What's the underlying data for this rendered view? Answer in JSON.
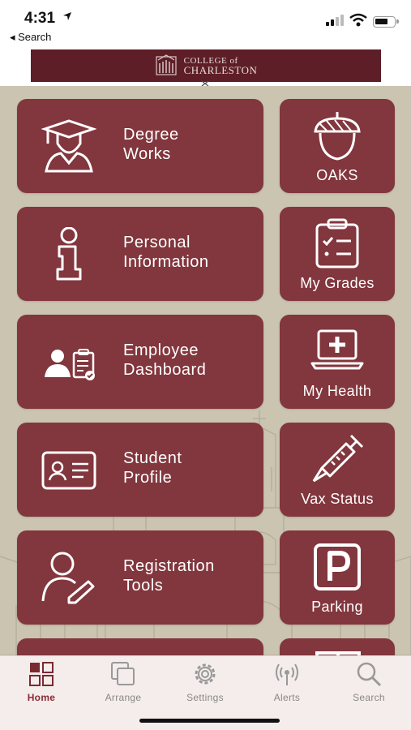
{
  "status_bar": {
    "time": "4:31",
    "back_label": "◂ Search"
  },
  "banner": {
    "brand_line1": "COLLEGE of",
    "brand_line2": "CHARLESTON"
  },
  "tiles": [
    {
      "label": "Degree\nWorks",
      "icon": "graduate-icon"
    },
    {
      "label": "OAKS",
      "icon": "acorn-icon"
    },
    {
      "label": "Personal\nInformation",
      "icon": "info-icon"
    },
    {
      "label": "My Grades",
      "icon": "clipboard-checklist-icon"
    },
    {
      "label": "Employee\nDashboard",
      "icon": "employee-clipboard-icon"
    },
    {
      "label": "My Health",
      "icon": "laptop-medical-icon"
    },
    {
      "label": "Student\nProfile",
      "icon": "id-card-icon"
    },
    {
      "label": "Vax Status",
      "icon": "syringe-icon"
    },
    {
      "label": "Registration\nTools",
      "icon": "user-edit-icon"
    },
    {
      "label": "Parking",
      "icon": "parking-icon"
    }
  ],
  "tabbar": {
    "tabs": [
      {
        "label": "Home",
        "icon": "grid-icon",
        "active": true
      },
      {
        "label": "Arrange",
        "icon": "stack-icon",
        "active": false
      },
      {
        "label": "Settings",
        "icon": "gear-icon",
        "active": false
      },
      {
        "label": "Alerts",
        "icon": "broadcast-icon",
        "active": false
      },
      {
        "label": "Search",
        "icon": "search-icon",
        "active": false
      }
    ]
  },
  "colors": {
    "tile": "#82363d",
    "banner": "#5e1e27",
    "background": "#cbc4b1",
    "active_tab": "#8a2c33",
    "inactive_tab": "#888888"
  }
}
